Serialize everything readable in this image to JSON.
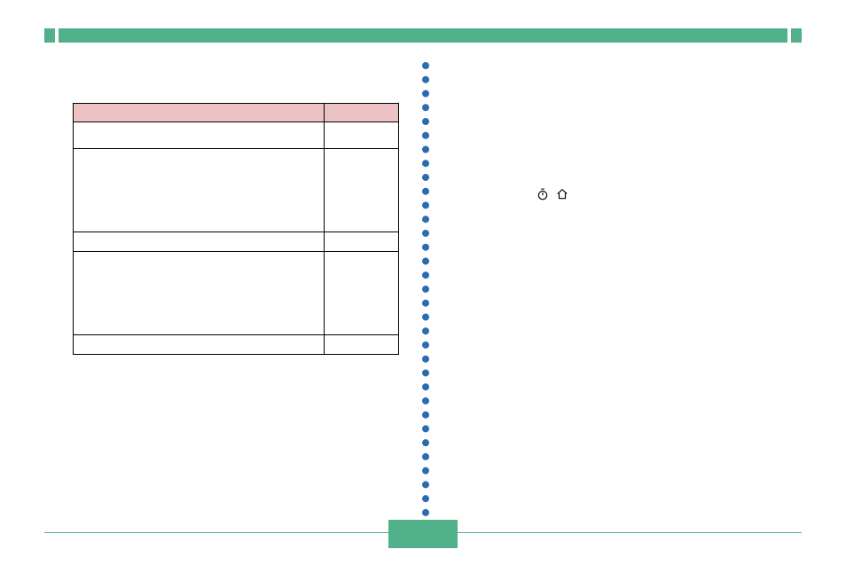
{
  "header": {
    "title": ""
  },
  "table": {
    "headers": [
      "",
      ""
    ],
    "rows": [
      {
        "c1": "",
        "c2": "",
        "h": "sm"
      },
      {
        "c1": "",
        "c2": "",
        "h": "lg"
      },
      {
        "c1": "",
        "c2": "",
        "h": "md"
      },
      {
        "c1": "",
        "c2": "",
        "h": "lg"
      },
      {
        "c1": "",
        "c2": "",
        "h": "md"
      }
    ]
  },
  "right_icons": {
    "timer": "timer-icon",
    "home": "home-icon"
  },
  "footer": {
    "page_label": ""
  },
  "colors": {
    "accent": "#4FB08A",
    "divider": "#2B6CB0",
    "table_header": "#ECC2C5"
  }
}
